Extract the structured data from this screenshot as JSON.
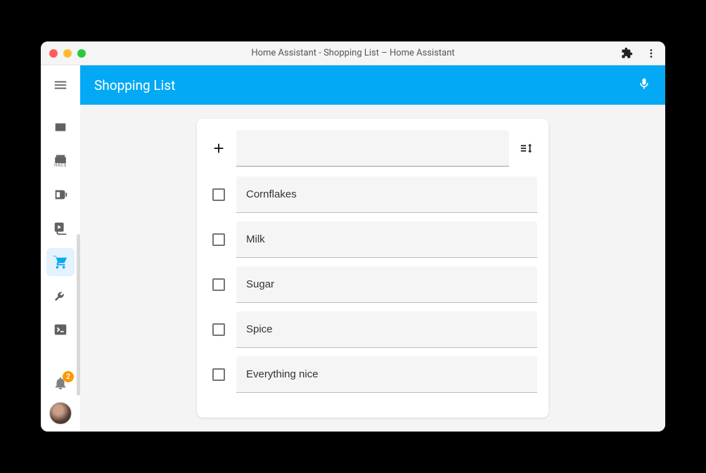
{
  "window": {
    "title": "Home Assistant - Shopping List – Home Assistant"
  },
  "appbar": {
    "title": "Shopping List"
  },
  "sidebar": {
    "hacs_label": "HACS",
    "badge_count": "2"
  },
  "shopping": {
    "new_item_value": "",
    "items": [
      {
        "name": "Cornflakes",
        "checked": false
      },
      {
        "name": "Milk",
        "checked": false
      },
      {
        "name": "Sugar",
        "checked": false
      },
      {
        "name": "Spice",
        "checked": false
      },
      {
        "name": "Everything nice",
        "checked": false
      }
    ]
  },
  "colors": {
    "accent": "#03a9f4",
    "badge": "#ff9800"
  }
}
